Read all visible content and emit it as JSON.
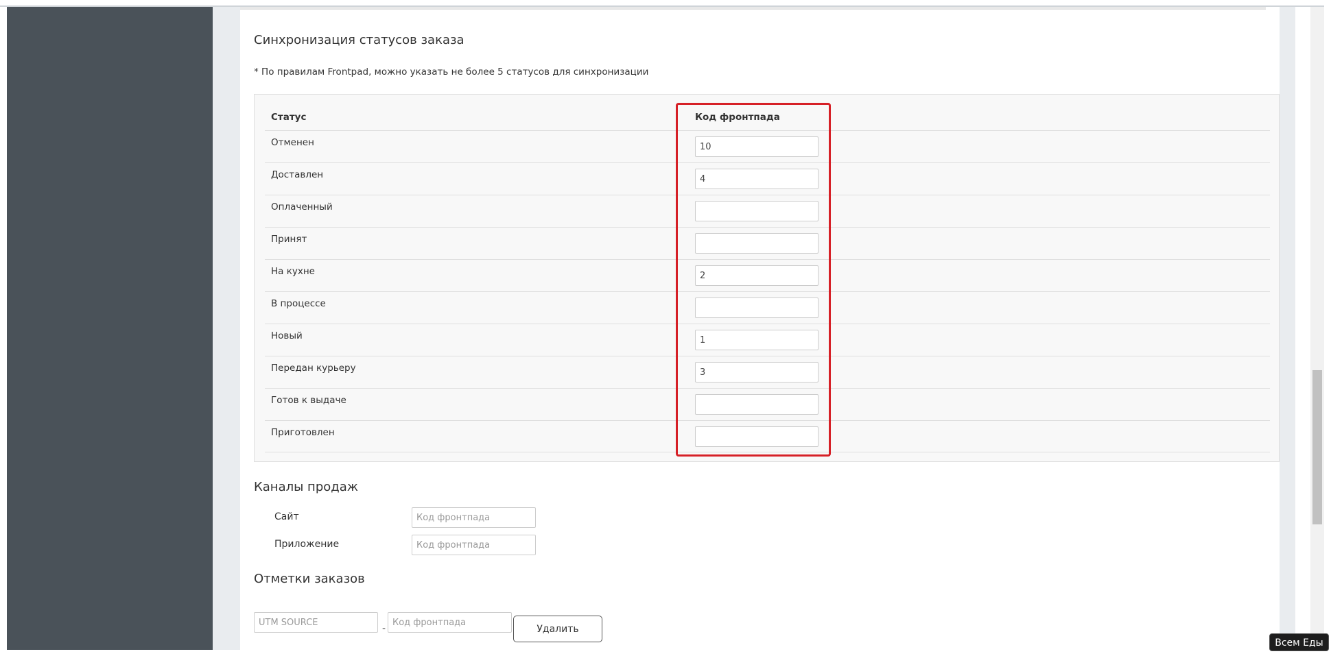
{
  "status_sync": {
    "title": "Синхронизация статусов заказа",
    "note": "* По правилам Frontpad, можно указать не более 5 статусов для синхронизации",
    "col_status": "Статус",
    "col_code": "Код фронтпада",
    "rows": [
      {
        "label": "Отменен",
        "code": "10"
      },
      {
        "label": "Доставлен",
        "code": "4"
      },
      {
        "label": "Оплаченный",
        "code": ""
      },
      {
        "label": "Принят",
        "code": ""
      },
      {
        "label": "На кухне",
        "code": "2"
      },
      {
        "label": "В процессе",
        "code": ""
      },
      {
        "label": "Новый",
        "code": "1"
      },
      {
        "label": "Передан курьеру",
        "code": "3"
      },
      {
        "label": "Готов к выдаче",
        "code": ""
      },
      {
        "label": "Приготовлен",
        "code": ""
      }
    ],
    "highlight_color": "#d62027"
  },
  "sales_channels": {
    "title": "Каналы продаж",
    "items": [
      {
        "label": "Сайт",
        "placeholder": "Код фронтпада"
      },
      {
        "label": "Приложение",
        "placeholder": "Код фронтпада"
      }
    ]
  },
  "order_marks": {
    "title": "Отметки заказов",
    "utm_placeholder": "UTM SOURCE",
    "separator": "-",
    "code_placeholder": "Код фронтпада",
    "delete_label": "Удалить"
  },
  "app_badge": "Всем Еды",
  "colors": {
    "sidebar": "#4a5259",
    "background": "#e9ecef",
    "card": "#f8f8f8"
  }
}
